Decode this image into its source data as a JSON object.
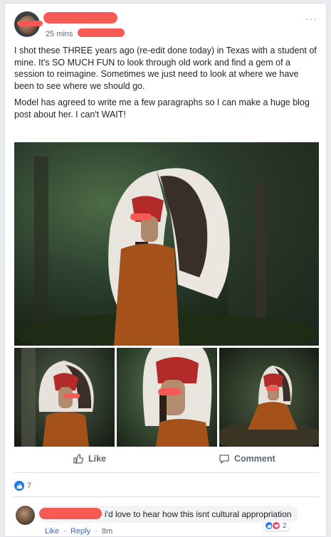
{
  "post": {
    "timestamp": "25 mins",
    "more_menu": "···",
    "paragraphs": [
      "I shot these THREE years ago (re-edit done today) in Texas with a student of mine. It's SO MUCH FUN to look through old work and find a gem of a session to reimagine. Sometimes we just need to look at where we have been to see where we should go.",
      "Model has agreed to write me a few paragraphs so I can make a huge blog post about her. I can't WAIT!"
    ]
  },
  "actions": {
    "like_label": "Like",
    "comment_label": "Comment",
    "like_icon": "thumbs-up-icon",
    "comment_icon": "comment-bubble-icon"
  },
  "reactions": {
    "like_count": "7"
  },
  "comment": {
    "text": "i'd love to hear how this isnt cultural appropriation",
    "reaction_count": "2",
    "like_label": "Like",
    "reply_label": "Reply",
    "separator": "·",
    "time": "8m"
  },
  "colors": {
    "accent": "#2078f4",
    "love": "#f33e58",
    "redaction": "#f55a54",
    "link": "#4267b2"
  }
}
